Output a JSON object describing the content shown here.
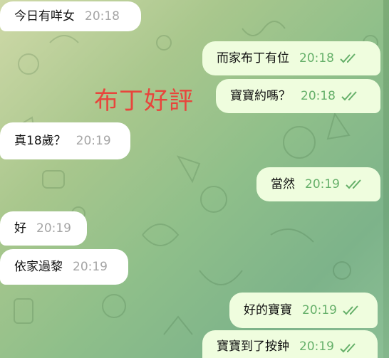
{
  "overlay_caption": "布丁好評",
  "messages": [
    {
      "dir": "in",
      "text": "今日有咩女",
      "time": "20:18"
    },
    {
      "dir": "out",
      "text": "而家布丁有位",
      "time": "20:18"
    },
    {
      "dir": "out",
      "text": "寶寶約嗎？",
      "time": "20:18"
    },
    {
      "dir": "in",
      "text": "真18歲？",
      "time": "20:19"
    },
    {
      "dir": "out",
      "text": "當然",
      "time": "20:19"
    },
    {
      "dir": "in",
      "text": "好",
      "time": "20:19"
    },
    {
      "dir": "in",
      "text": "依家過黎",
      "time": "20:19"
    },
    {
      "dir": "out",
      "text": "好的寶寶",
      "time": "20:19"
    },
    {
      "dir": "out",
      "text": "寶寶到了按鈡",
      "time": "20:19"
    }
  ],
  "colors": {
    "incoming_bubble": "#ffffff",
    "outgoing_bubble": "#effdde",
    "outgoing_time": "#66b06a",
    "incoming_time": "#a5a5a5",
    "caption": "#e8453c"
  },
  "icons": {
    "read_status": "double-check-icon"
  }
}
